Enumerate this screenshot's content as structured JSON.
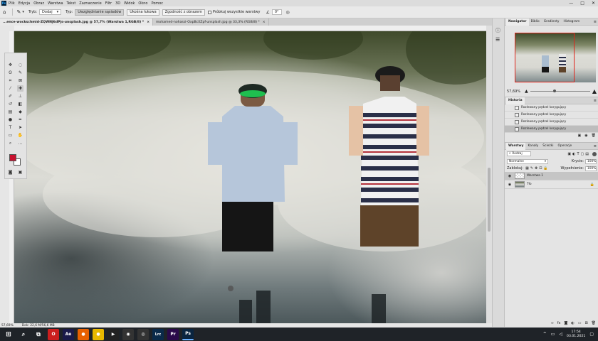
{
  "menubar": {
    "logo": "Ps",
    "items": [
      "Plik",
      "Edycja",
      "Obraz",
      "Warstwa",
      "Tekst",
      "Zaznaczenie",
      "Filtr",
      "3D",
      "Widok",
      "Okno",
      "Pomoc"
    ],
    "window_controls": [
      "—",
      "□",
      "✕"
    ]
  },
  "options": {
    "tryb_label": "Tryb:",
    "tryb_value": "Dodaj",
    "typ_label": "Typ:",
    "btn_active": "Uwzględnianie sąsiadów",
    "btn_2": "Ukośna łukowa",
    "btn_3": "Zgodność z obrazem",
    "sample_all": "Próbkuj wszystkie warstwy",
    "angle_value": "0°"
  },
  "tabs": [
    {
      "label": "...ence-wockschmid-ZQWNJ6dPjs-unsplash.jpg @ 57,7% (Warstwa 1,RGB/8) *",
      "active": true
    },
    {
      "label": "mohamed-nohassi-OxpBcXZpf-unsplash.jpg @ 33,3% (RGB/8) *",
      "active": false
    }
  ],
  "tools": [
    {
      "name": "move-tool-icon",
      "glyph": "✥"
    },
    {
      "name": "marquee-tool-icon",
      "glyph": "◌"
    },
    {
      "name": "lasso-tool-icon",
      "glyph": "ʘ"
    },
    {
      "name": "quick-select-tool-icon",
      "glyph": "✎"
    },
    {
      "name": "crop-tool-icon",
      "glyph": "⌗"
    },
    {
      "name": "frame-tool-icon",
      "glyph": "⊠"
    },
    {
      "name": "eyedropper-tool-icon",
      "glyph": "⁄"
    },
    {
      "name": "healing-brush-tool-icon",
      "glyph": "✚"
    },
    {
      "name": "brush-tool-icon",
      "glyph": "✐"
    },
    {
      "name": "stamp-tool-icon",
      "glyph": "⊥"
    },
    {
      "name": "history-brush-tool-icon",
      "glyph": "↺"
    },
    {
      "name": "eraser-tool-icon",
      "glyph": "◧"
    },
    {
      "name": "gradient-tool-icon",
      "glyph": "▤"
    },
    {
      "name": "blur-tool-icon",
      "glyph": "◆"
    },
    {
      "name": "dodge-tool-icon",
      "glyph": "●"
    },
    {
      "name": "pen-tool-icon",
      "glyph": "✒"
    },
    {
      "name": "type-tool-icon",
      "glyph": "T"
    },
    {
      "name": "path-select-tool-icon",
      "glyph": "➤"
    },
    {
      "name": "rectangle-tool-icon",
      "glyph": "▭"
    },
    {
      "name": "hand-tool-icon",
      "glyph": "✋"
    },
    {
      "name": "zoom-tool-icon",
      "glyph": "⌕"
    },
    {
      "name": "more-tools-icon",
      "glyph": "…"
    }
  ],
  "colors": {
    "foreground": "#c8102e",
    "background": "#ffffff",
    "accent_red": "#e0241b"
  },
  "status": {
    "zoom": "57,69%",
    "doc_info": "Dok: 22,6 M/56,6 MB"
  },
  "navigator": {
    "tabs": [
      "Nawigator",
      "Biblio",
      "Gradienty",
      "Histogram"
    ],
    "zoom": "57,69%"
  },
  "history": {
    "title": "Historia",
    "items": [
      "Rozlewany pędzel korygujący",
      "Rozlewany pędzel korygujący",
      "Rozlewany pędzel korygujący",
      "Rozlewany pędzel korygujący"
    ]
  },
  "layers": {
    "tabs": [
      "Warstwy",
      "Kanały",
      "Ścieżki",
      "Operacje"
    ],
    "filter_label": "Rodzaj",
    "blend_mode": "Normalne",
    "opacity_label": "Krycie:",
    "opacity_value": "100%",
    "lock_label": "Zablokuj:",
    "fill_label": "Wypełnienie:",
    "fill_value": "100%",
    "items": [
      {
        "name": "Warstwa 1",
        "active": true
      },
      {
        "name": "Tło",
        "active": false
      }
    ],
    "bottom_icons": [
      "link-icon",
      "fx-icon",
      "mask-icon",
      "adjustment-icon",
      "folder-icon",
      "new-layer-icon",
      "trash-icon"
    ]
  },
  "taskbar": {
    "apps": [
      {
        "name": "windows-start-icon",
        "glyph": "⊞",
        "color": "#1f2328"
      },
      {
        "name": "opera-icon",
        "glyph": "O",
        "color": "#cc1e1e"
      },
      {
        "name": "after-effects-icon",
        "glyph": "Ae",
        "color": "#1a1a4a"
      },
      {
        "name": "firefox-icon",
        "glyph": "●",
        "color": "#e66000"
      },
      {
        "name": "chrome-icon",
        "glyph": "●",
        "color": "#e8b800"
      },
      {
        "name": "video-player-icon",
        "glyph": "▶",
        "color": "#222"
      },
      {
        "name": "obs-icon",
        "glyph": "◉",
        "color": "#333"
      },
      {
        "name": "media-icon",
        "glyph": "◎",
        "color": "#333"
      },
      {
        "name": "lightroom-classic-icon",
        "glyph": "Lrc",
        "color": "#0a2a4a"
      },
      {
        "name": "premiere-icon",
        "glyph": "Pr",
        "color": "#2a0a4a"
      },
      {
        "name": "photoshop-icon",
        "glyph": "Ps",
        "color": "#0a2540"
      }
    ],
    "time": "17:54",
    "date": "03.01.2021"
  }
}
